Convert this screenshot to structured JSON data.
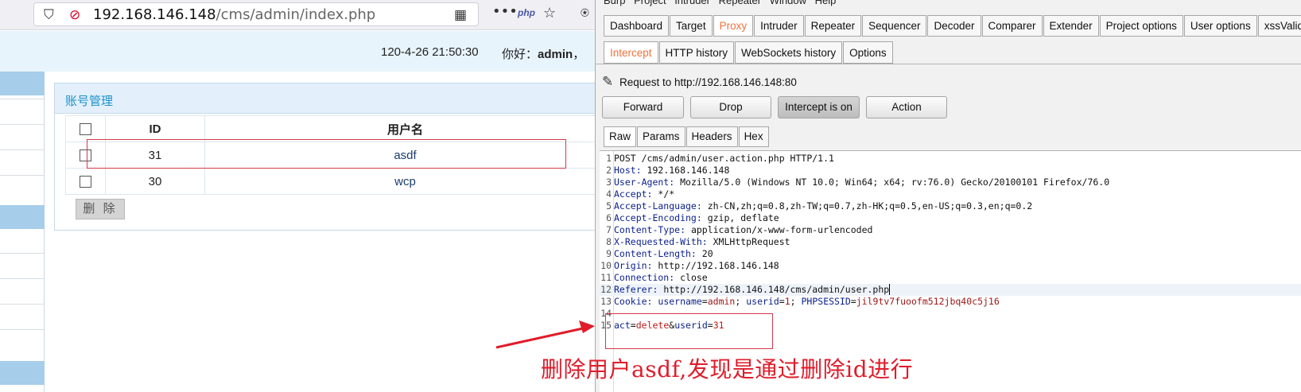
{
  "browser": {
    "url_host": "192.168.146.148",
    "url_path": "/cms/admin/index.php",
    "php_label": "php",
    "datetime": "120-4-26 21:50:30",
    "greeting_prefix": "你好：",
    "greeting_user": "admin",
    "greeting_suffix": "，"
  },
  "account_panel": {
    "title": "账号管理",
    "columns": [
      "ID",
      "用户名"
    ],
    "rows": [
      {
        "id": "31",
        "username": "asdf"
      },
      {
        "id": "30",
        "username": "wcp"
      }
    ],
    "delete_label": "删 除"
  },
  "burp": {
    "menu": [
      "Burp",
      "Project",
      "Intruder",
      "Repeater",
      "Window",
      "Help"
    ],
    "main_tabs": [
      "Dashboard",
      "Target",
      "Proxy",
      "Intruder",
      "Repeater",
      "Sequencer",
      "Decoder",
      "Comparer",
      "Extender",
      "Project options",
      "User options",
      "xssValidator"
    ],
    "active_main_tab": "Proxy",
    "proxy_tabs": [
      "Intercept",
      "HTTP history",
      "WebSockets history",
      "Options"
    ],
    "active_proxy_tab": "Intercept",
    "request_to": "Request to http://192.168.146.148:80",
    "buttons": {
      "forward": "Forward",
      "drop": "Drop",
      "intercept": "Intercept is on",
      "action": "Action"
    },
    "view_tabs": [
      "Raw",
      "Params",
      "Headers",
      "Hex"
    ],
    "active_view_tab": "Raw",
    "request_lines": [
      {
        "n": "1",
        "k": "POST /cms/admin/user.action.php HTTP/1.1",
        "v": ""
      },
      {
        "n": "2",
        "k": "Host:",
        "v": " 192.168.146.148"
      },
      {
        "n": "3",
        "k": "User-Agent:",
        "v": " Mozilla/5.0 (Windows NT 10.0; Win64; x64; rv:76.0) Gecko/20100101 Firefox/76.0"
      },
      {
        "n": "4",
        "k": "Accept:",
        "v": " */*"
      },
      {
        "n": "5",
        "k": "Accept-Language:",
        "v": " zh-CN,zh;q=0.8,zh-TW;q=0.7,zh-HK;q=0.5,en-US;q=0.3,en;q=0.2"
      },
      {
        "n": "6",
        "k": "Accept-Encoding:",
        "v": " gzip, deflate"
      },
      {
        "n": "7",
        "k": "Content-Type:",
        "v": " application/x-www-form-urlencoded"
      },
      {
        "n": "8",
        "k": "X-Requested-With:",
        "v": " XMLHttpRequest"
      },
      {
        "n": "9",
        "k": "Content-Length:",
        "v": " 20"
      },
      {
        "n": "10",
        "k": "Origin:",
        "v": " http://192.168.146.148"
      },
      {
        "n": "11",
        "k": "Connection:",
        "v": " close"
      },
      {
        "n": "12",
        "k": "Referer:",
        "v": " http://192.168.146.148/cms/admin/user.php"
      },
      {
        "n": "13",
        "k": "Cookie:",
        "v": ""
      },
      {
        "n": "14",
        "k": "",
        "v": ""
      },
      {
        "n": "15",
        "k": "",
        "v": ""
      }
    ],
    "cookie": [
      {
        "k": "username",
        "v": "admin"
      },
      {
        "k": "userid",
        "v": "1"
      },
      {
        "k": "PHPSESSID",
        "v": "jil9tv7fuoofm512jbq40c5j16"
      }
    ],
    "body": [
      {
        "k": "act",
        "v": "delete"
      },
      {
        "k": "userid",
        "v": "31"
      }
    ]
  },
  "annotation": {
    "note": "删除用户asdf,发现是通过删除id进行"
  },
  "colors": {
    "accent_orange": "#f0713c",
    "annotation_red": "#e01c2a",
    "panel_title_blue": "#1e90c9"
  }
}
